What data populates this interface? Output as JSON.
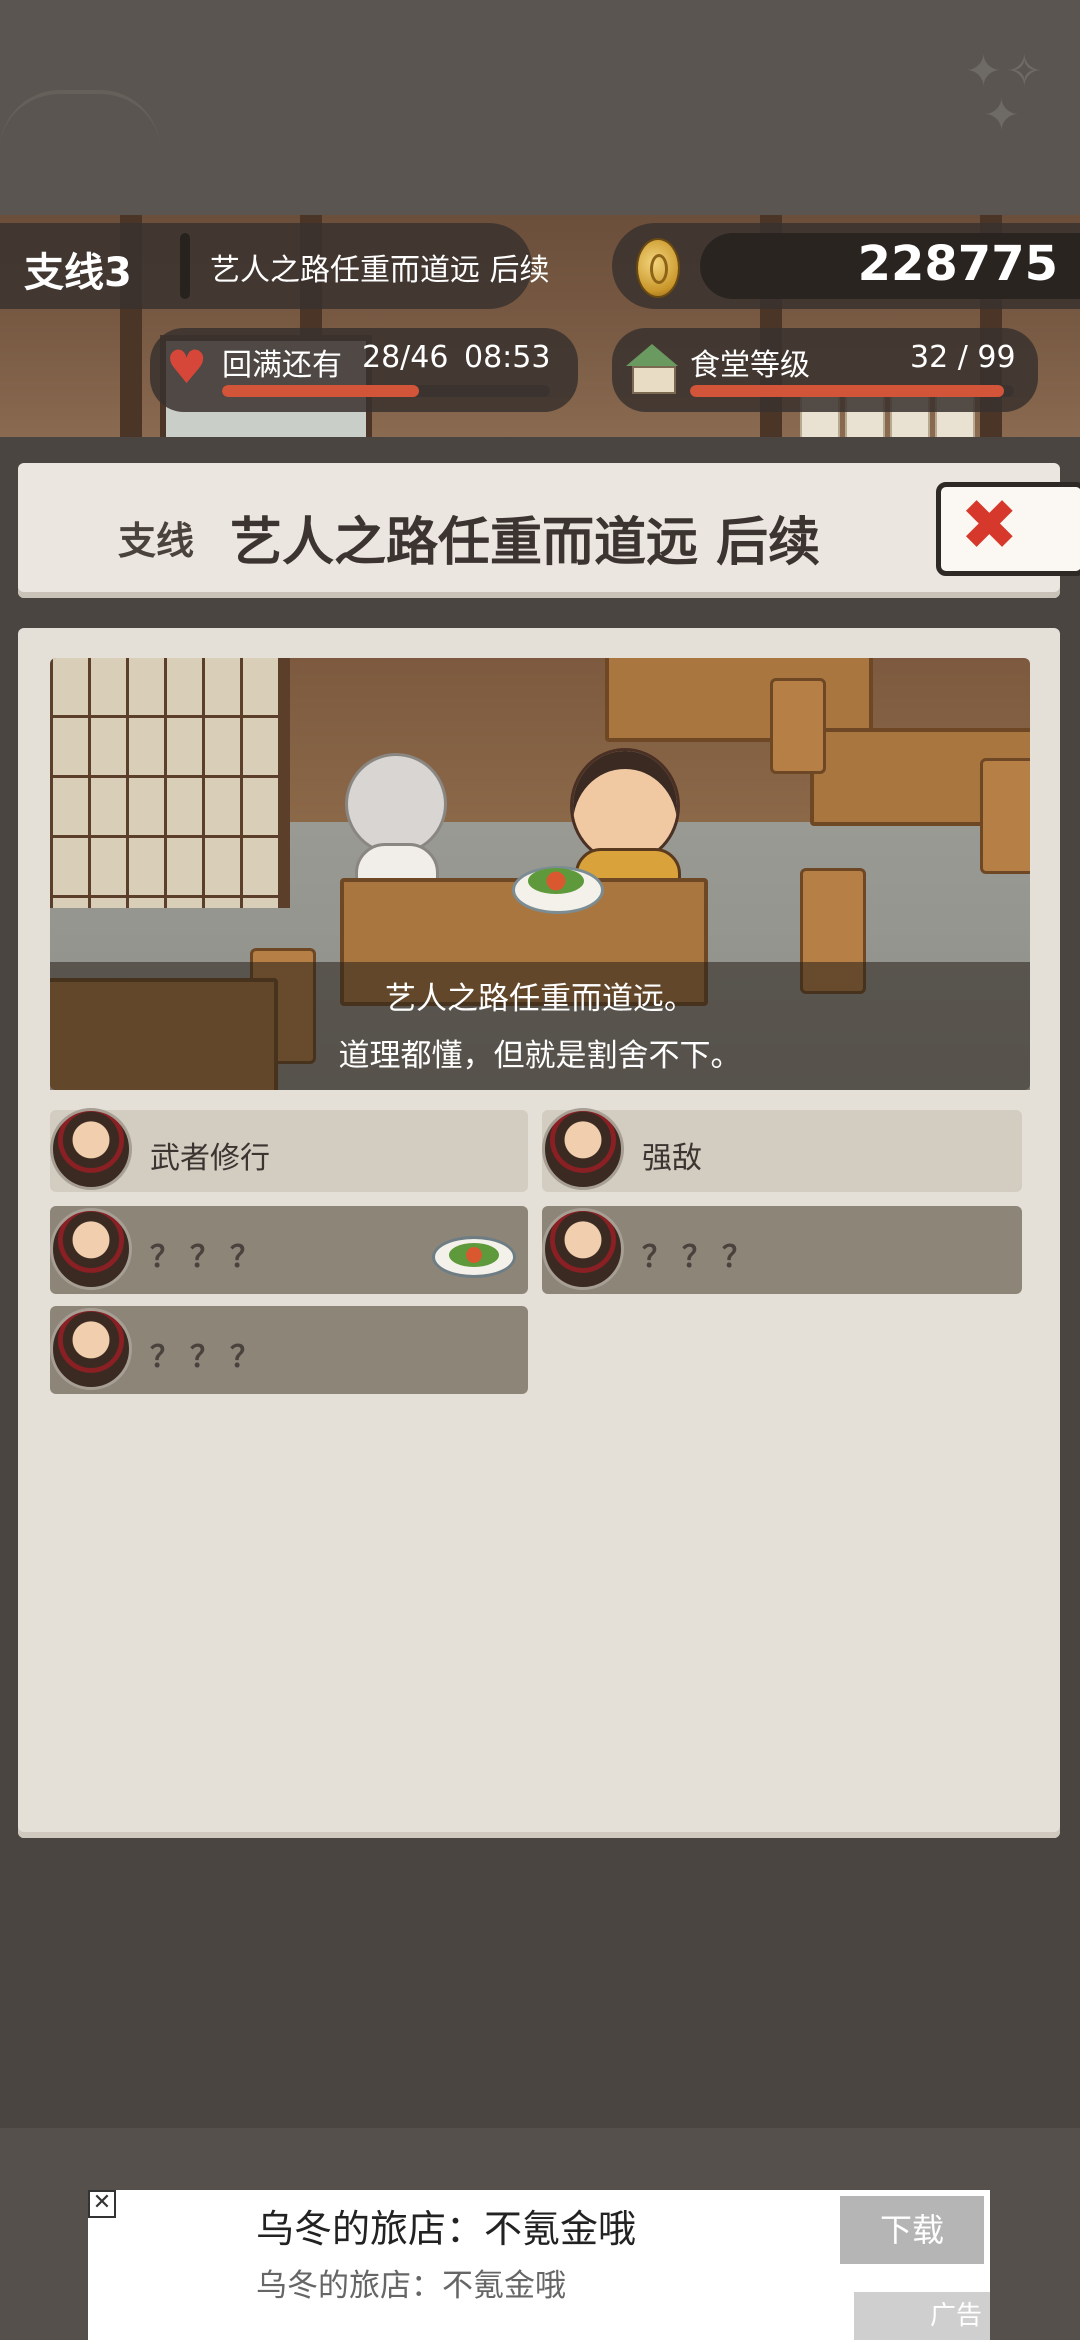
{
  "header": {
    "chapter_label": "支线3",
    "chapter_title": "艺人之路任重而道远 后续",
    "coins": "228775",
    "coin_icon": "coin-icon",
    "stamina_label": "回满还有",
    "stamina_count": "28/46",
    "stamina_timer": "08:53",
    "stamina_fraction": 0.6,
    "level_label": "食堂等级",
    "level_count": "32 / 99",
    "level_fraction": 0.97,
    "accent_color": "#d2553a"
  },
  "panel": {
    "title_prefix": "支线",
    "title": "艺人之路任重而道远 后续",
    "close_label": "✖"
  },
  "scene": {
    "caption_line1": "艺人之路任重而道远。",
    "caption_line2": "道理都懂，但就是割舍不下。"
  },
  "quests": [
    {
      "label": "武者修行",
      "locked": false
    },
    {
      "label": "强敌",
      "locked": false
    },
    {
      "label": "？？？",
      "locked": true,
      "has_dish": true
    },
    {
      "label": "？？？",
      "locked": true
    },
    {
      "label": "？？？",
      "locked": true
    }
  ],
  "ad": {
    "title": "乌冬的旅店：不氪金哦",
    "subtitle": "乌冬的旅店：不氪金哦",
    "button": "下载",
    "tag": "广告",
    "close": "✕"
  }
}
